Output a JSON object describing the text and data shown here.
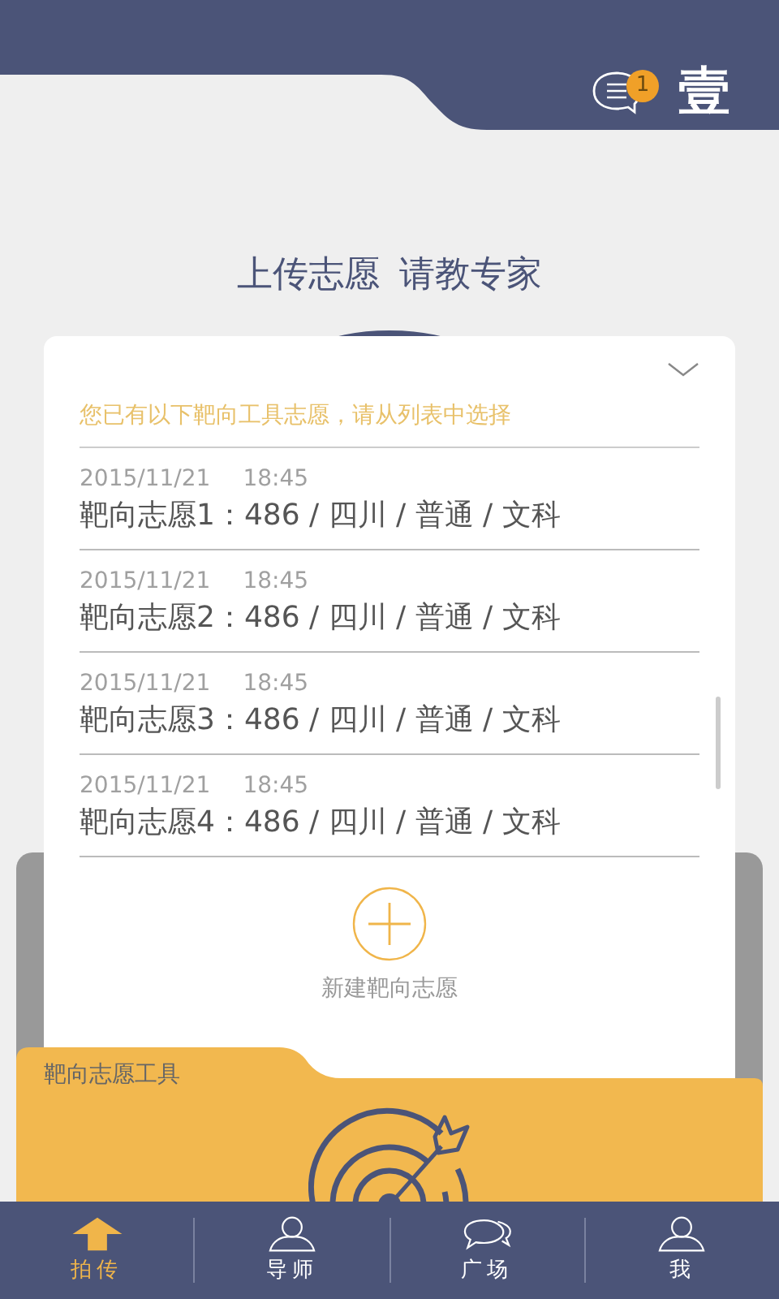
{
  "header": {
    "message_badge": "1",
    "logo": "壹"
  },
  "headline": [
    "上传志愿",
    "请教专家"
  ],
  "popup": {
    "prompt": "您已有以下靶向工具志愿，请从列表中选择",
    "entries": [
      {
        "date": "2015/11/21",
        "time": "18:45",
        "summary": "靶向志愿1：486 / 四川 / 普通 / 文科"
      },
      {
        "date": "2015/11/21",
        "time": "18:45",
        "summary": "靶向志愿2：486 / 四川 / 普通 / 文科"
      },
      {
        "date": "2015/11/21",
        "time": "18:45",
        "summary": "靶向志愿3：486 / 四川 / 普通 / 文科"
      },
      {
        "date": "2015/11/21",
        "time": "18:45",
        "summary": "靶向志愿4：486 / 四川 / 普通 / 文科"
      }
    ],
    "new_button": "新建靶向志愿"
  },
  "tool_folder": {
    "title": "靶向志愿工具"
  },
  "tabs": [
    {
      "label": "拍传",
      "selected": true
    },
    {
      "label": "导师",
      "selected": false
    },
    {
      "label": "广场",
      "selected": false
    },
    {
      "label": "我",
      "selected": false
    }
  ]
}
